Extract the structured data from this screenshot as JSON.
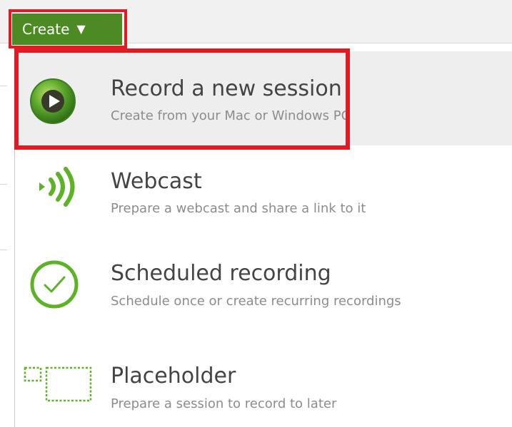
{
  "create_button": {
    "label": "Create",
    "caret": "▼"
  },
  "menu": {
    "items": [
      {
        "title": "Record a new session",
        "description": "Create from your Mac or Windows PC",
        "icon": "record-play-icon",
        "selected": true
      },
      {
        "title": "Webcast",
        "description": "Prepare a webcast and share a link to it",
        "icon": "broadcast-icon",
        "selected": false
      },
      {
        "title": "Scheduled recording",
        "description": "Schedule once or create recurring recordings",
        "icon": "check-circle-icon",
        "selected": false
      },
      {
        "title": "Placeholder",
        "description": "Prepare a session to record to later",
        "icon": "placeholder-frames-icon",
        "selected": false
      }
    ]
  },
  "colors": {
    "accent_green": "#4c8a23",
    "icon_green": "#5cb325",
    "highlight_red": "#e01b24",
    "title_text": "#444444",
    "description_text": "#8c8c8c"
  }
}
